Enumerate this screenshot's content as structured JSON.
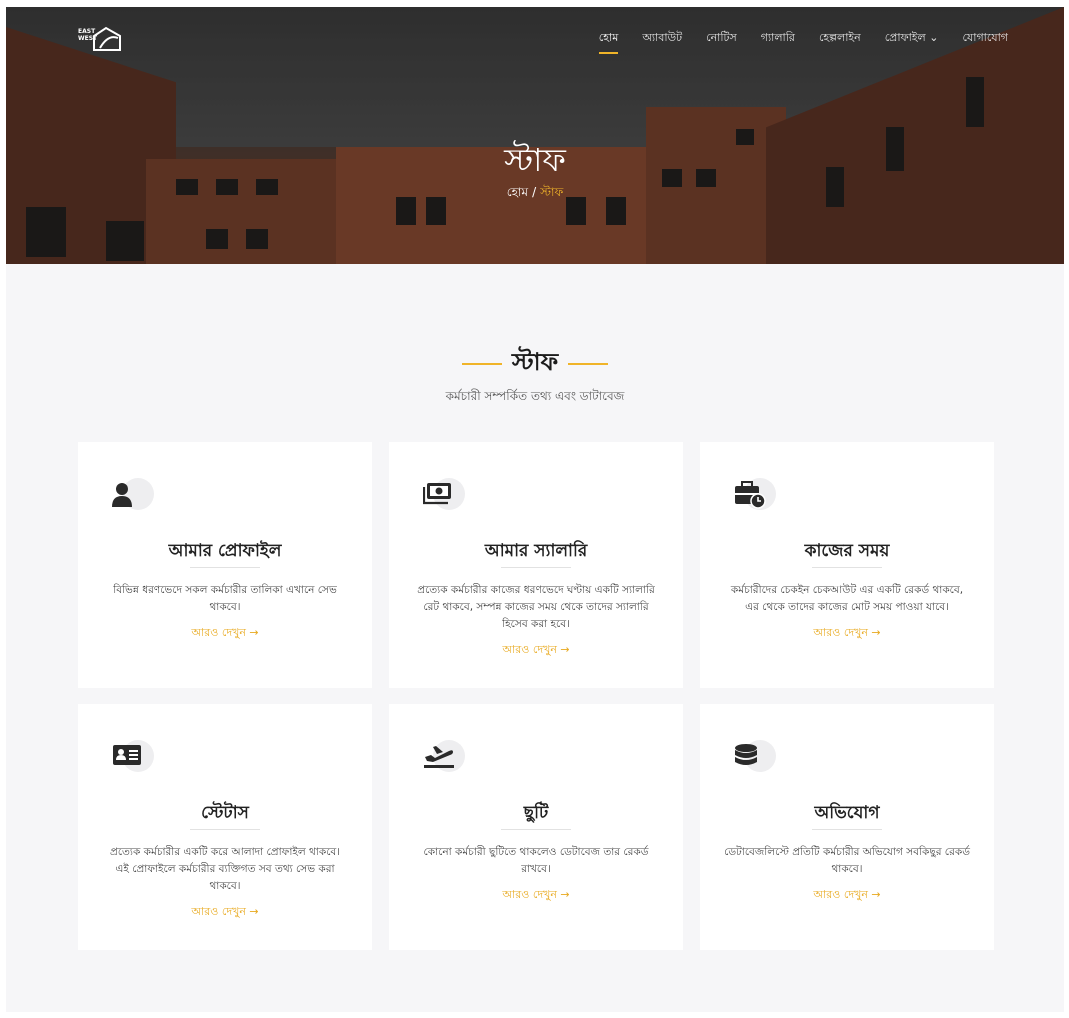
{
  "nav": {
    "logo_text": "EAST WEST",
    "items": [
      {
        "label": "হোম",
        "active": true
      },
      {
        "label": "অ্যাবাউট"
      },
      {
        "label": "নোটিস"
      },
      {
        "label": "গ্যালারি"
      },
      {
        "label": "হেল্পলাইন"
      },
      {
        "label": "প্রোফাইল ⌄"
      },
      {
        "label": "যোগাযোগ"
      }
    ]
  },
  "hero": {
    "title": "স্টাফ",
    "breadcrumb_home": "হোম",
    "breadcrumb_sep": "/",
    "breadcrumb_current": "স্টাফ"
  },
  "section": {
    "title": "স্টাফ",
    "subtitle": "কর্মচারী সম্পর্কিত তথ্য এবং ডাটাবেজ"
  },
  "cards": [
    {
      "title": "আমার প্রোফাইল",
      "icon": "user-icon",
      "text": "বিভিন্ন ধরণভেদে সকল কর্মচারীর তালিকা এখানে সেভ থাকবে।",
      "more": "আরও দেখুন →"
    },
    {
      "title": "আমার স্যালারি",
      "icon": "money-icon",
      "text": "প্রত্যেক কর্মচারীর কাজের ধরণভেদে ঘণ্টায় একটি স্যালারি রেট থাকবে, সম্পন্ন কাজের সময় থেকে তাদের স্যালারি হিসেব করা হবে।",
      "more": "আরও দেখুন →"
    },
    {
      "title": "কাজের সময়",
      "icon": "briefcase-clock-icon",
      "text": "কর্মচারীদের চেকইন চেকআউট এর একটি রেকর্ড থাকবে, এর থেকে তাদের কাজের মোট সময় পাওয়া যাবে।",
      "more": "আরও দেখুন →"
    },
    {
      "title": "স্টেটাস",
      "icon": "id-card-icon",
      "text": "প্রত্যেক কর্মচারীর একটি করে আলাদা প্রোফাইল থাকবে। এই প্রোফাইলে কর্মচারীর ব্যক্তিগত সব তথ্য সেভ করা থাকবে।",
      "more": "আরও দেখুন →"
    },
    {
      "title": "ছুটি",
      "icon": "plane-departure-icon",
      "text": "কোনো কর্মচারী ছুটিতে থাকলেও ডেটাবেজ তার রেকর্ড রাখবে।",
      "more": "আরও দেখুন →"
    },
    {
      "title": "অভিযোগ",
      "icon": "database-icon",
      "text": "ডেটাবেজলিস্টে প্রতিটি কর্মচারীর অভিযোগ সবকিছুর রেকর্ড থাকবে।",
      "more": "আরও দেখুন →"
    }
  ],
  "colors": {
    "accent": "#f0b429",
    "link": "#e8a91e",
    "bg": "#f6f6f8"
  }
}
